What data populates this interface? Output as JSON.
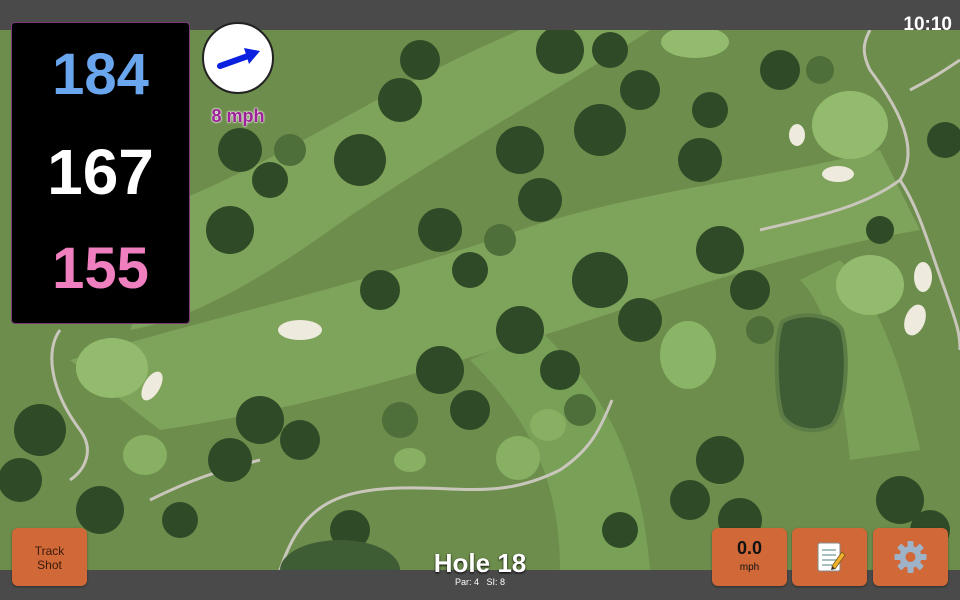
{
  "status": {
    "time": "10:10"
  },
  "distances": {
    "back": "184",
    "middle": "167",
    "front": "155"
  },
  "wind": {
    "speed_label": "8 mph",
    "icon": "arrow-right-icon"
  },
  "hole": {
    "title": "Hole 18",
    "par_label": "Par: 4",
    "si_label": "SI: 8"
  },
  "buttons": {
    "track_shot": "Track\nShot",
    "speed_value": "0.0",
    "speed_unit": "mph",
    "notes_icon": "memo-icon",
    "settings_icon": "gear-icon"
  },
  "colors": {
    "back": "#6aa6ee",
    "middle": "#ffffff",
    "front": "#f07fc0",
    "button": "#d06838",
    "wind_text": "#a01f9a"
  }
}
